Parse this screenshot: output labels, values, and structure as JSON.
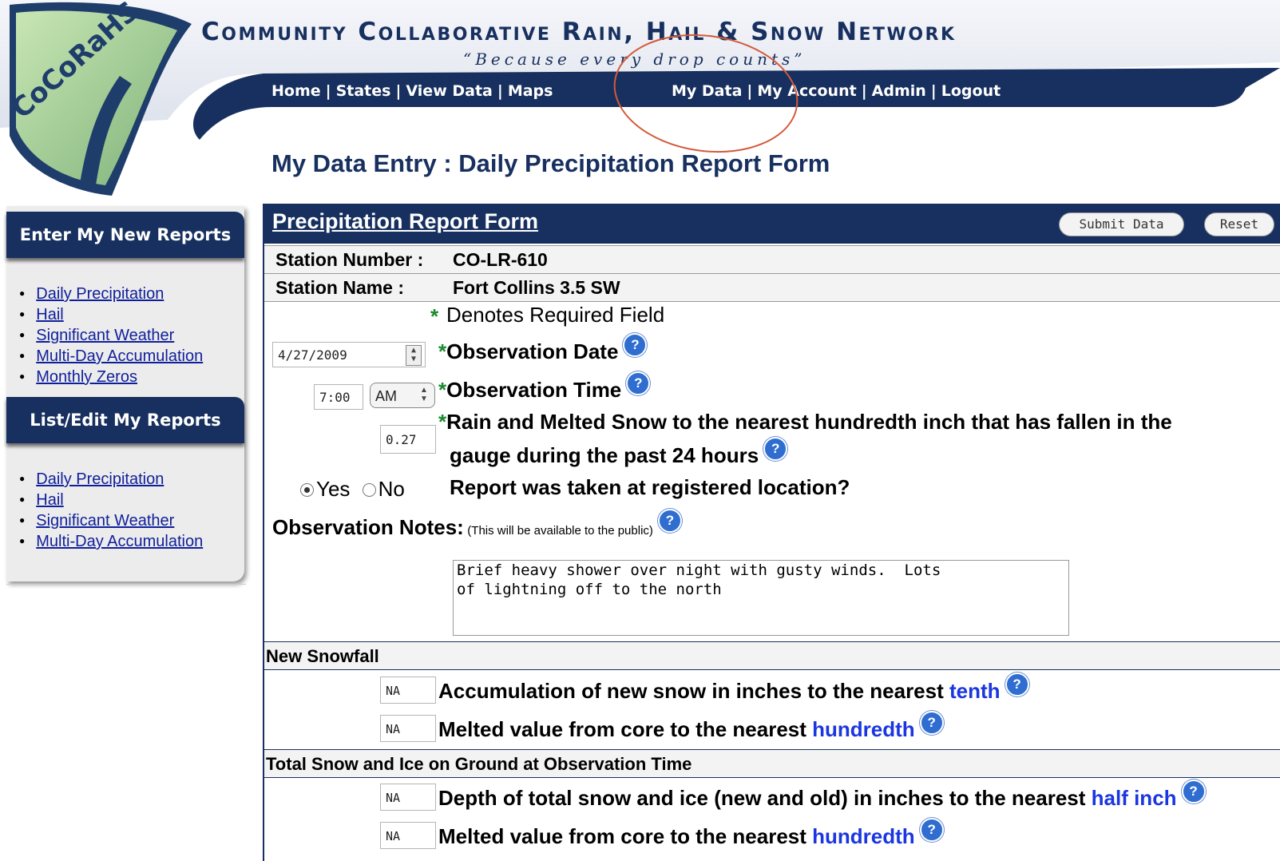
{
  "header": {
    "logo_text": "CoCoRaHS",
    "site_title": "Community Collaborative Rain, Hail & Snow Network",
    "tagline": "“Because every drop counts”",
    "nav_left": [
      "Home",
      "States",
      "View Data",
      "Maps"
    ],
    "nav_right": [
      "My Data",
      "My Account",
      "Admin",
      "Logout"
    ],
    "separator": "|",
    "colors": {
      "navy": "#17305f",
      "annotation_circle": "#d45a3a"
    }
  },
  "page_title": "My Data Entry : Daily Precipitation Report Form",
  "sidebar": {
    "section1_title": "Enter My New Reports",
    "section1_items": [
      "Daily Precipitation",
      "Hail",
      "Significant Weather",
      "Multi-Day Accumulation",
      "Monthly Zeros"
    ],
    "section2_title": "List/Edit My Reports",
    "section2_items": [
      "Daily Precipitation",
      "Hail",
      "Significant Weather",
      "Multi-Day Accumulation"
    ]
  },
  "form": {
    "title": "Precipitation Report Form",
    "submit_label": "Submit Data",
    "reset_label": "Reset",
    "station_number_label": "Station Number :",
    "station_number": "CO-LR-610",
    "station_name_label": "Station Name :",
    "station_name": "Fort Collins 3.5 SW",
    "required_star": "*",
    "required_note": "Denotes Required Field",
    "obs_date_value": "4/27/2009",
    "obs_date_label": "Observation Date",
    "obs_time_value": "7:00",
    "obs_ampm": "AM",
    "obs_time_label": "Observation Time",
    "rain_value": "0.27",
    "rain_label_line1": "Rain and Melted Snow to the nearest hundredth inch that has fallen in the",
    "rain_label_line2": "gauge during the past 24 hours",
    "radio_yes": "Yes",
    "radio_no": "No",
    "radio_selected": "Yes",
    "location_question": "Report was taken at registered location?",
    "notes_label": "Observation Notes:",
    "notes_sublabel": "(This will be available to the public)",
    "notes_value": "Brief heavy shower over night with gusty winds.  Lots\nof lightning off to the north",
    "help_glyph": "?"
  },
  "new_snowfall": {
    "section_title": "New Snowfall",
    "accum_value": "NA",
    "accum_label": "Accumulation of new snow in inches to the nearest",
    "accum_unit": "tenth",
    "melted_value": "NA",
    "melted_label": "Melted value from core to the nearest",
    "melted_unit": "hundredth"
  },
  "total_snow": {
    "section_title": "Total Snow and Ice on Ground at Observation Time",
    "depth_value": "NA",
    "depth_label": "Depth of total snow and ice (new and old) in inches to the nearest",
    "depth_unit": "half inch",
    "melted_value": "NA",
    "melted_label": "Melted value from core to the nearest",
    "melted_unit": "hundredth"
  }
}
